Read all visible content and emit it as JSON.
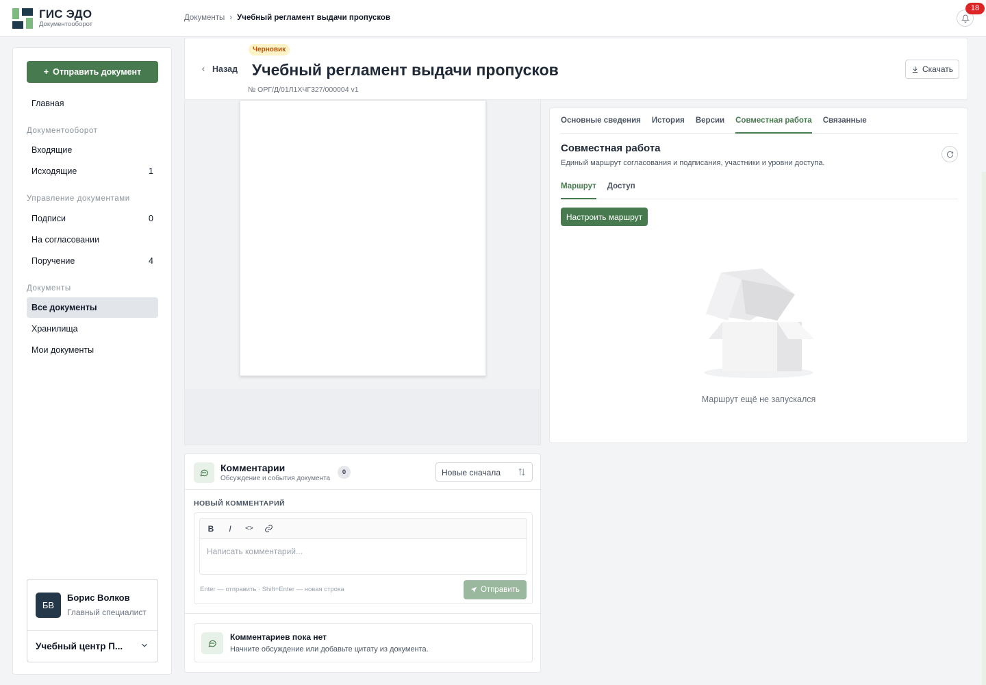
{
  "header": {
    "brand_title": "ГИС ЭДО",
    "brand_subtitle": "Документооборот",
    "breadcrumb_root": "Документы",
    "breadcrumb_sep": "›",
    "breadcrumb_current": "Учебный регламент выдачи пропусков",
    "notifications_count": "18"
  },
  "sidebar": {
    "send_button": "Отправить документ",
    "home": "Главная",
    "section_docflow": "Документооборот",
    "incoming": "Входящие",
    "outgoing": "Исходящие",
    "outgoing_count": "1",
    "section_management": "Управление документами",
    "signatures": "Подписи",
    "signatures_count": "0",
    "approval": "На согласовании",
    "assignment": "Поручение",
    "assignment_count": "4",
    "section_documents": "Документы",
    "all_docs": "Все документы",
    "storages": "Хранилища",
    "my_docs": "Мои документы",
    "user": {
      "initials": "БВ",
      "name": "Борис Волков",
      "role": "Главный специалист",
      "org": "Учебный центр П..."
    }
  },
  "document": {
    "status": "Черновик",
    "back": "Назад",
    "title": "Учебный регламент выдачи пропусков",
    "number": "№ ОРГ/Д/01Л1ХЧГ327/000004  v1",
    "download": "Скачать"
  },
  "panel": {
    "tabs": [
      "Основные сведения",
      "История",
      "Версии",
      "Совместная работа",
      "Связанные"
    ],
    "active_tab": "Совместная работа",
    "title": "Совместная работа",
    "subtitle": "Единый маршрут согласования и подписания, участники и уровни доступа.",
    "subtabs": [
      "Маршрут",
      "Доступ"
    ],
    "route_button": "Настроить маршрут",
    "empty_text": "Маршрут ещё не запускался"
  },
  "comments": {
    "title": "Комментарии",
    "subtitle": "Обсуждение и события документа",
    "count": "0",
    "sort": "Новые сначала",
    "new_label": "НОВЫЙ КОММЕНТАРИЙ",
    "toolbar": {
      "bold": "B",
      "italic": "I",
      "code": "<>"
    },
    "placeholder": "Написать комментарий...",
    "hint": "Enter — отправить · Shift+Enter — новая строка",
    "send": "Отправить",
    "empty_title": "Комментариев пока нет",
    "empty_sub": "Начните обсуждение или добавьте цитату из документа."
  },
  "colors": {
    "accent": "#477a4f",
    "dark": "#24384a",
    "badge": "#dc2626"
  }
}
